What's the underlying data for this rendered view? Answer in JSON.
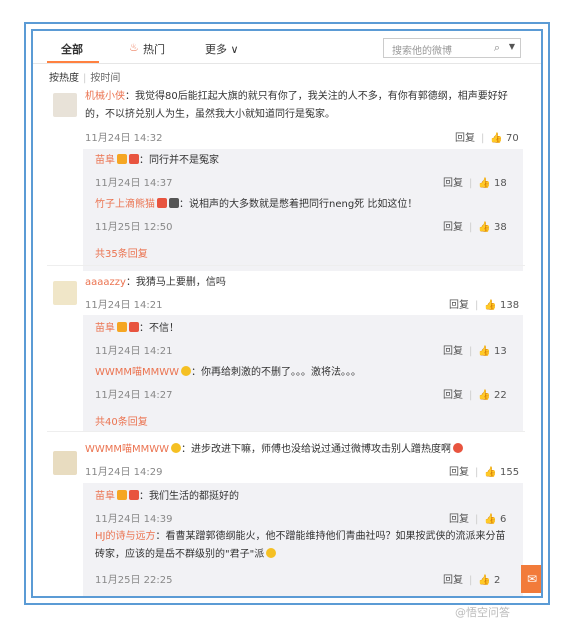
{
  "tabs": {
    "all": "全部",
    "hot": "热门",
    "more": "更多 ∨",
    "hot_icon": "flame-icon"
  },
  "search": {
    "placeholder": "搜索他的微博"
  },
  "sort": {
    "by_hot": "按热度",
    "by_time": "按时间"
  },
  "actions_label": "回复",
  "comments": [
    {
      "name": "机械小侠",
      "text_line1": "：我觉得80后能扛起大旗的就只有你了，我关注的人不多，有你有郭德纲，相声要好好",
      "text_line2": "的，不以挤兑别人为生，虽然我大小就知道同行是冤家。",
      "time": "11月24日 14:32",
      "likes": "70",
      "replies": [
        {
          "name": "苗阜",
          "text": "：同行并不是冤家",
          "time": "11月24日 14:37",
          "likes": "18"
        },
        {
          "name": "竹子上滴熊猫",
          "text": "：说相声的大多数就是憋着把同行neng死 比如这位！",
          "time": "11月25日 12:50",
          "likes": "38"
        }
      ],
      "more": "共35条回复"
    },
    {
      "name": "aaaazzy",
      "text": "：我猜马上要删，信吗",
      "time": "11月24日 14:21",
      "likes": "138",
      "replies": [
        {
          "name": "苗阜",
          "text": "：不信！",
          "time": "11月24日 14:21",
          "likes": "13"
        },
        {
          "name": "WWMM喵MMWW",
          "text": "：你再给刺激的不删了。。。激将法。。。",
          "time": "11月24日 14:27",
          "likes": "22"
        }
      ],
      "more": "共40条回复"
    },
    {
      "name": "WWMM喵MMWW",
      "text": "：进步改进下嘛，师傅也没给说过通过微博攻击别人蹭热度啊",
      "time": "11月24日 14:29",
      "likes": "155",
      "replies": [
        {
          "name": "苗阜",
          "text": "：我们生活的都挺好的",
          "time": "11月24日 14:39",
          "likes": "6"
        },
        {
          "name": "HJ的诗与远方",
          "text_line1": "：看曹某蹭郭德纲能火，他不蹭能维持他们青曲社吗？如果按武侠的流派来分苗",
          "text_line2": "砖家，应该的是岳不群级别的\"君子\"派",
          "time": "11月25日 22:25",
          "likes": "2"
        }
      ]
    }
  ],
  "watermark": "@悟空问答"
}
